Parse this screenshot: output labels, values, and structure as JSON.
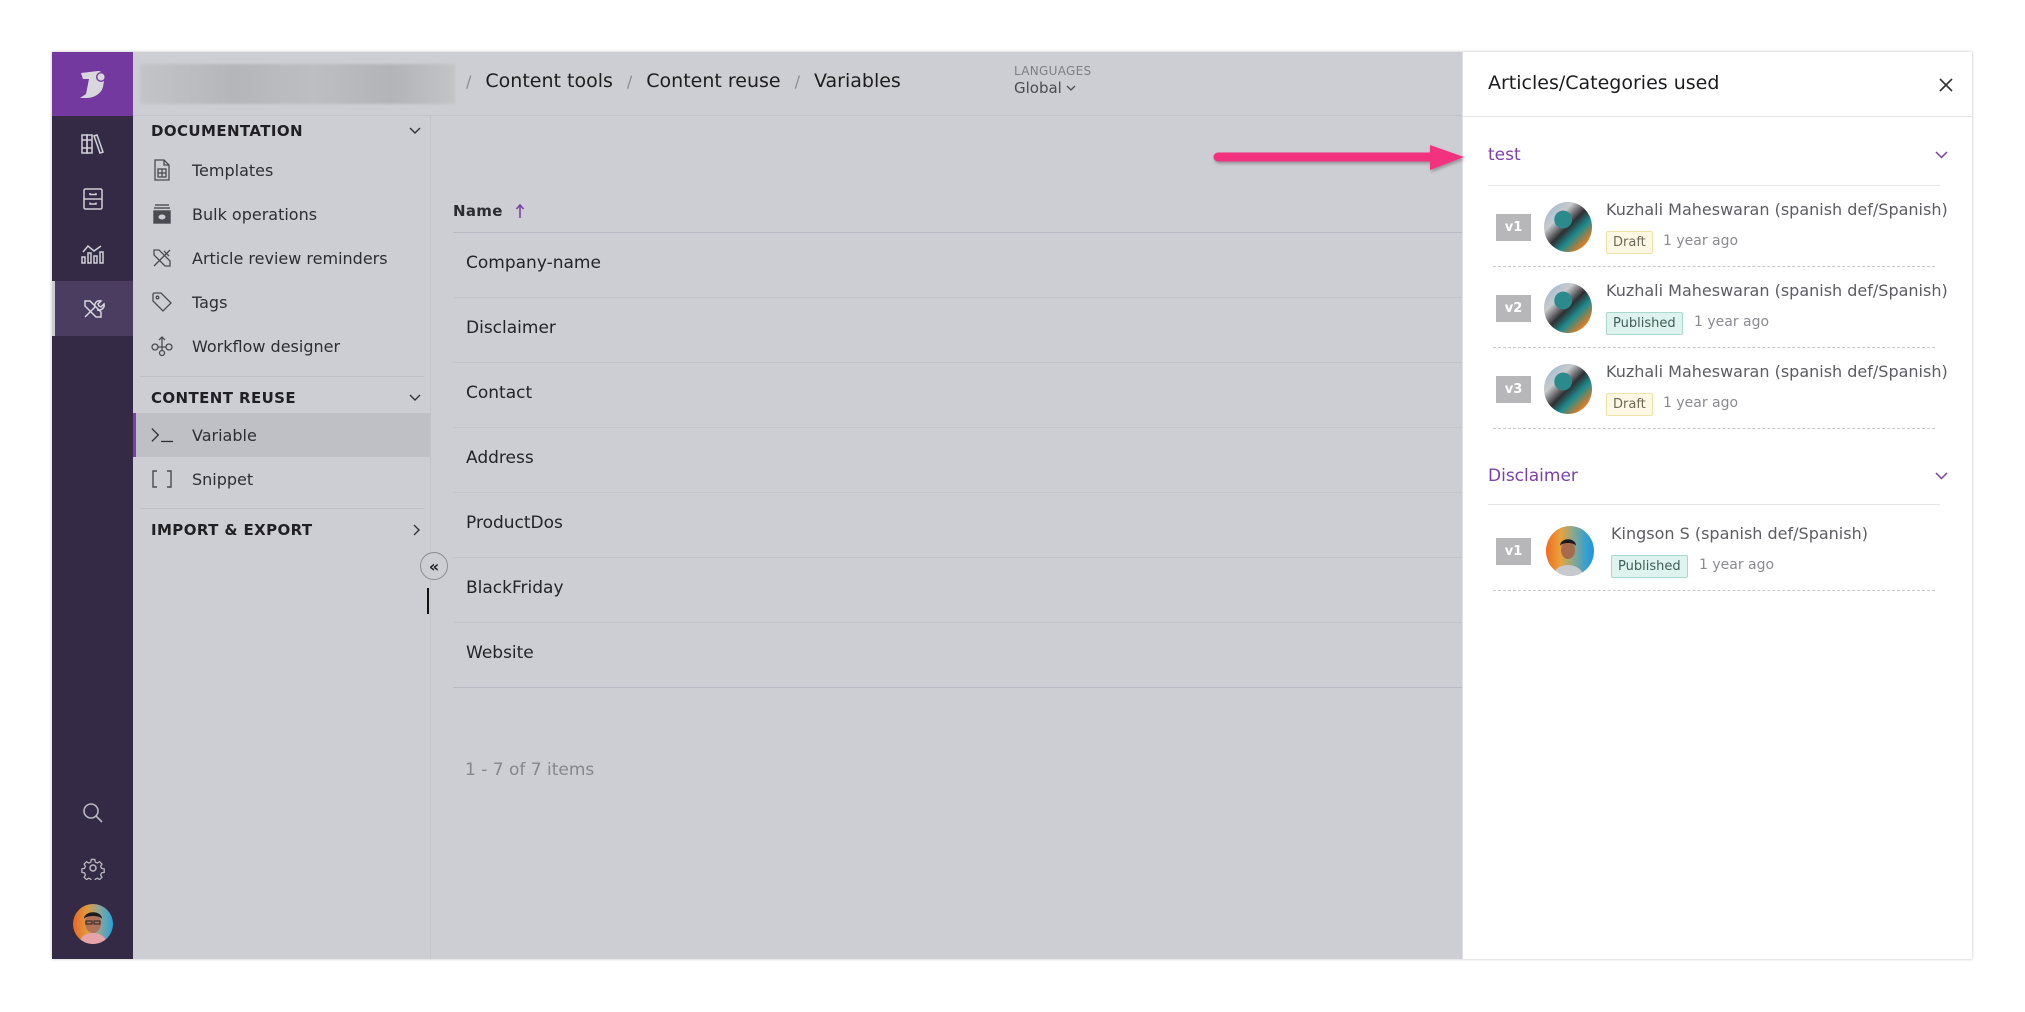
{
  "rail": {
    "logo": "document360-logo",
    "items": [
      {
        "name": "knowledge-base",
        "icon": "books-icon"
      },
      {
        "name": "drive",
        "icon": "cabinet-icon"
      },
      {
        "name": "analytics",
        "icon": "analytics-icon"
      },
      {
        "name": "content-tools",
        "icon": "tools-icon",
        "active": true
      }
    ],
    "bottom": [
      {
        "name": "search",
        "icon": "search-icon"
      },
      {
        "name": "settings",
        "icon": "gear-icon"
      }
    ]
  },
  "header": {
    "breadcrumbs": [
      "Content tools",
      "Content reuse",
      "Variables"
    ],
    "languages_label": "LANGUAGES",
    "language_value": "Global"
  },
  "sidebar": {
    "sections": [
      {
        "title": "DOCUMENTATION",
        "expanded": true,
        "items": [
          {
            "label": "Templates",
            "icon": "template-icon"
          },
          {
            "label": "Bulk operations",
            "icon": "bulk-operations-icon"
          },
          {
            "label": "Article review reminders",
            "icon": "review-reminder-icon"
          },
          {
            "label": "Tags",
            "icon": "tag-icon"
          },
          {
            "label": "Workflow designer",
            "icon": "workflow-icon"
          }
        ]
      },
      {
        "title": "CONTENT REUSE",
        "expanded": true,
        "items": [
          {
            "label": "Variable",
            "icon": "terminal-icon",
            "active": true
          },
          {
            "label": "Snippet",
            "icon": "brackets-icon"
          }
        ]
      },
      {
        "title": "IMPORT & EXPORT",
        "expanded": false,
        "items": []
      }
    ]
  },
  "table": {
    "column": "Name",
    "sort": "ascending",
    "rows": [
      "Company-name",
      "Disclaimer",
      "Contact",
      "Address",
      "ProductDos",
      "BlackFriday",
      "Website"
    ],
    "pagination": "1 - 7 of 7 items"
  },
  "panel": {
    "title": "Articles/Categories used",
    "groups": [
      {
        "title": "test",
        "entries": [
          {
            "version": "v1",
            "name": "Kuzhali Maheswaran (spanish def/Spanish)",
            "status": "Draft",
            "time": "1 year ago"
          },
          {
            "version": "v2",
            "name": "Kuzhali Maheswaran (spanish def/Spanish)",
            "status": "Published",
            "time": "1 year ago"
          },
          {
            "version": "v3",
            "name": "Kuzhali Maheswaran (spanish def/Spanish)",
            "status": "Draft",
            "time": "1 year ago"
          }
        ]
      },
      {
        "title": "Disclaimer",
        "entries": [
          {
            "version": "v1",
            "name": "Kingson S (spanish def/Spanish)",
            "status": "Published",
            "time": "1 year ago"
          }
        ]
      }
    ]
  },
  "colors": {
    "brand": "#74399e",
    "rail": "#352a46",
    "accent_link": "#7d3fa8",
    "annotation_arrow": "#f2337f",
    "draft_bg": "#fdf8e3",
    "published_bg": "#def3ee"
  }
}
